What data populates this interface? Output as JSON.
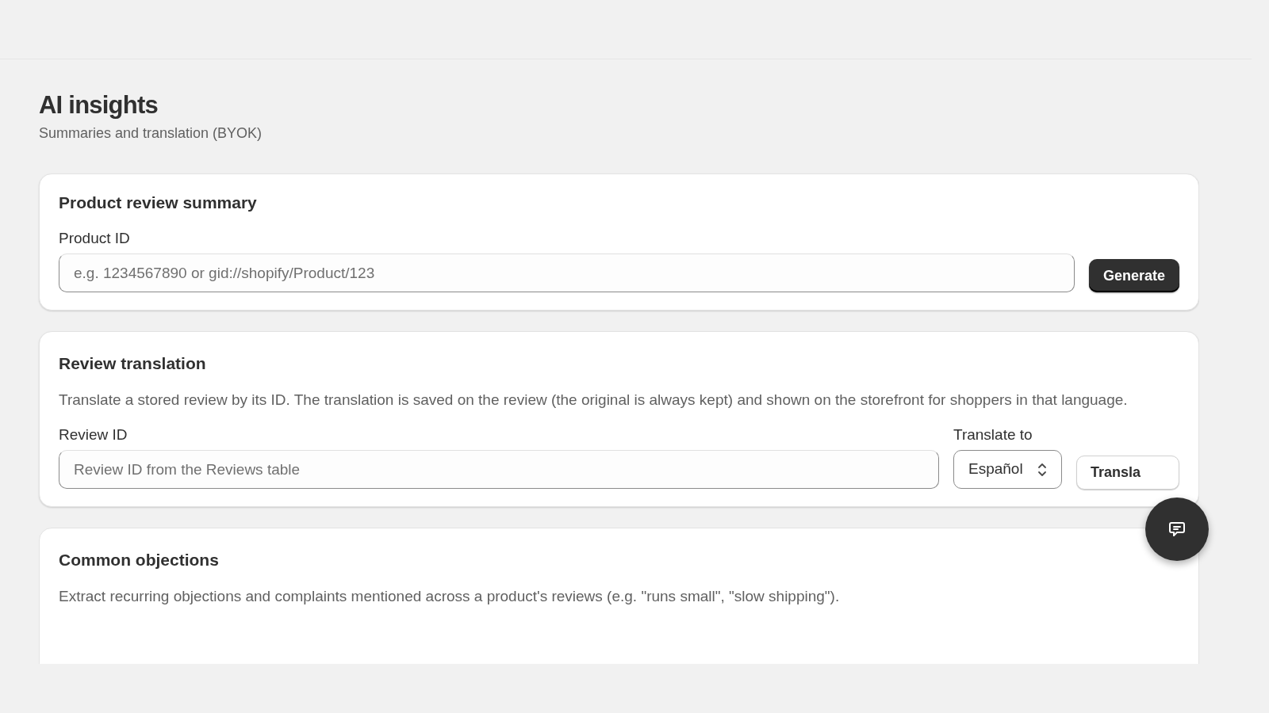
{
  "page": {
    "title": "AI insights",
    "subtitle": "Summaries and translation (BYOK)"
  },
  "product_summary": {
    "heading": "Product review summary",
    "field_label": "Product ID",
    "placeholder": "e.g. 1234567890 or gid://shopify/Product/123",
    "button": "Generate"
  },
  "review_translation": {
    "heading": "Review translation",
    "description": "Translate a stored review by its ID. The translation is saved on the review (the original is always kept) and shown on the storefront for shoppers in that language.",
    "field_label": "Review ID",
    "placeholder": "Review ID from the Reviews table",
    "select_label": "Translate to",
    "select_value": "Español",
    "button": "Transla"
  },
  "common_objections": {
    "heading": "Common objections",
    "description": "Extract recurring objections and complaints mentioned across a product's reviews (e.g. \"runs small\", \"slow shipping\")."
  }
}
